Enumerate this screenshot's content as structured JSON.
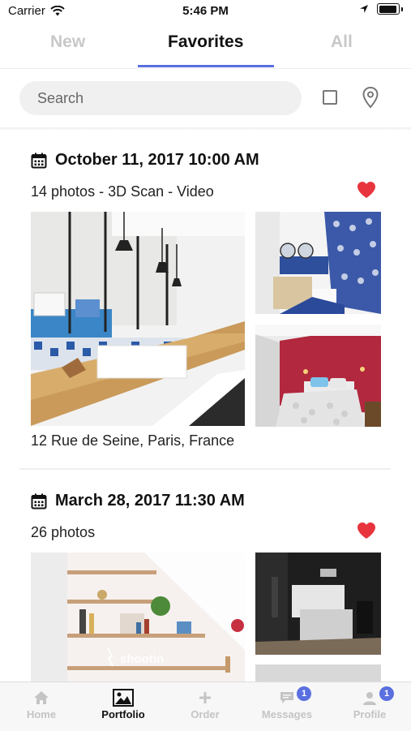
{
  "status_bar": {
    "carrier": "Carrier",
    "time": "5:46 PM"
  },
  "tabs": [
    {
      "label": "New",
      "active": false
    },
    {
      "label": "Favorites",
      "active": true
    },
    {
      "label": "All",
      "active": false
    }
  ],
  "search": {
    "placeholder": "Search",
    "value": ""
  },
  "icons": {
    "filter": "checkbox-square-icon",
    "location": "map-pin-icon",
    "favorite": "heart-icon",
    "calendar": "calendar-icon"
  },
  "colors": {
    "accent": "#5a6fe0",
    "heart": "#e8343c",
    "inactive": "#c4c4c4"
  },
  "listings": [
    {
      "date": "October 11, 2017 10:00 AM",
      "info": "14 photos - 3D Scan - Video",
      "favorite": true,
      "address": "12 Rue de Seine, Paris, France"
    },
    {
      "date": "March 28, 2017 11:30 AM",
      "info": "26 photos",
      "favorite": true,
      "watermark": "shootin"
    }
  ],
  "tabbar": [
    {
      "label": "Home",
      "icon": "home-icon",
      "active": false
    },
    {
      "label": "Portfolio",
      "icon": "image-icon",
      "active": true
    },
    {
      "label": "Order",
      "icon": "plus-icon",
      "active": false
    },
    {
      "label": "Messages",
      "icon": "chat-icon",
      "active": false,
      "badge": "1"
    },
    {
      "label": "Profile",
      "icon": "user-icon",
      "active": false,
      "badge": "1"
    }
  ]
}
